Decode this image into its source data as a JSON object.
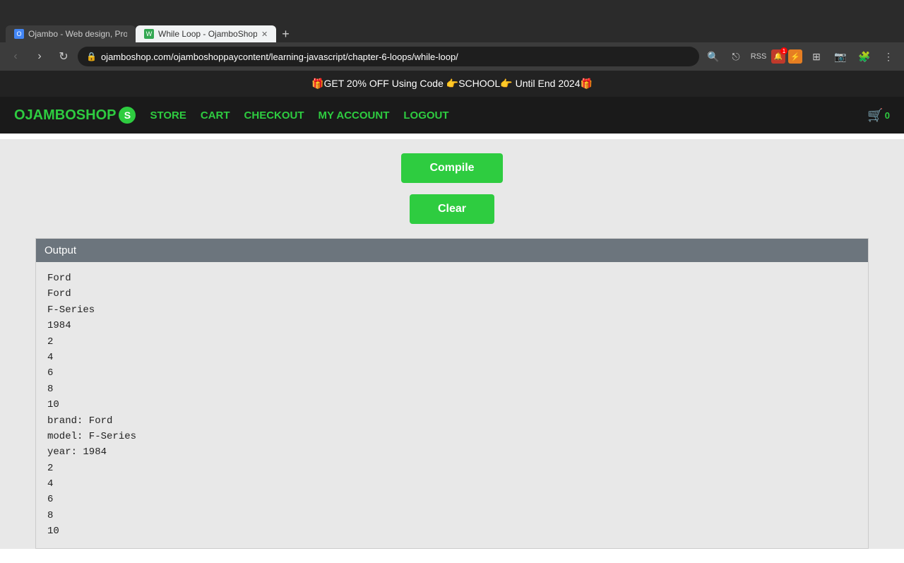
{
  "browser": {
    "tabs": [
      {
        "id": "tab1",
        "favicon_type": "blue",
        "label": "Ojambo - Web design, Progra...",
        "active": false
      },
      {
        "id": "tab2",
        "favicon_type": "green",
        "label": "While Loop - OjamboShop",
        "active": true
      }
    ],
    "url": "ojamboshop.com/ojamboshoppaycontent/learning-javascript/chapter-6-loops/while-loop/",
    "nav": {
      "back": "‹",
      "forward": "›",
      "reload": "↻"
    }
  },
  "promo": {
    "text": "🎁GET 20% OFF Using Code 👉SCHOOL👉 Until End 2024🎁"
  },
  "nav": {
    "logo": "OJAMBOSHOP",
    "logo_s": "S",
    "links": [
      {
        "label": "STORE",
        "href": "#"
      },
      {
        "label": "CART",
        "href": "#"
      },
      {
        "label": "CHECKOUT",
        "href": "#"
      },
      {
        "label": "MY ACCOUNT",
        "href": "#"
      },
      {
        "label": "LOGOUT",
        "href": "#"
      }
    ],
    "cart_icon": "🛒",
    "cart_count": "0"
  },
  "buttons": {
    "compile_label": "Compile",
    "clear_label": "Clear"
  },
  "output": {
    "header": "Output",
    "lines": [
      "Ford",
      "Ford",
      "F-Series",
      "1984",
      "2",
      "4",
      "6",
      "8",
      "10",
      "brand: Ford",
      "model: F-Series",
      "year: 1984",
      "2",
      "4",
      "6",
      "8",
      "10"
    ]
  }
}
